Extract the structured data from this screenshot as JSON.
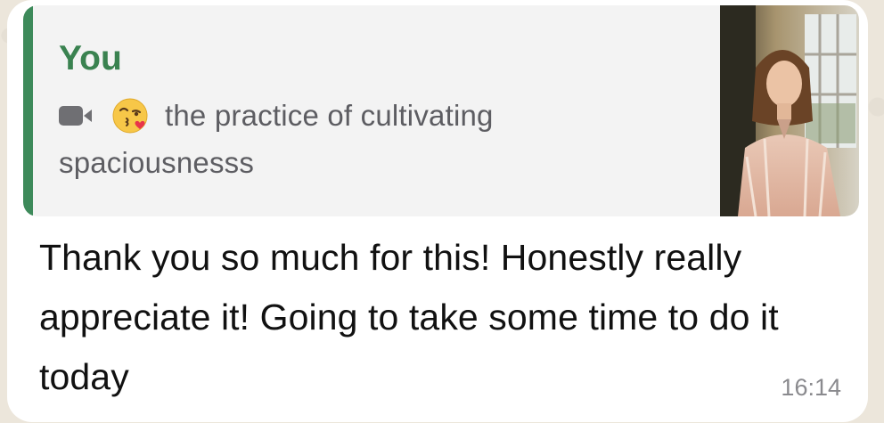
{
  "quote": {
    "author": "You",
    "media_icon": "video-camera-icon",
    "emoji_icon": "face-blowing-kiss-icon",
    "text_line1": "the practice of cultivating",
    "text_line2": "spaciousnesss",
    "thumbnail": "video-thumbnail-image"
  },
  "message": {
    "text": "Thank you so much for this! Honestly really appreciate it! Going to take some time to do it today",
    "time": "16:14"
  },
  "colors": {
    "quote_accent": "#3d8a5a",
    "quote_author": "#3a8250",
    "bubble_bg": "#ffffff",
    "quote_bg": "#f3f3f3"
  }
}
